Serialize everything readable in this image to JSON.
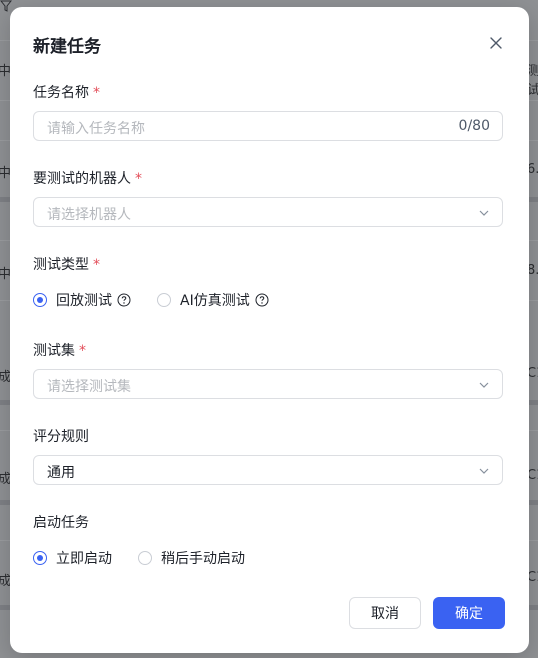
{
  "background": {
    "left_fragments": [
      "中",
      "中",
      "中",
      "成",
      "成",
      "成"
    ],
    "right_fragments": [
      "测试",
      "6.",
      "8.",
      "C1",
      "C1",
      "C1"
    ]
  },
  "dialog": {
    "title": "新建任务",
    "required_mark": "*",
    "task_name": {
      "label": "任务名称",
      "placeholder": "请输入任务名称",
      "counter": "0/80"
    },
    "robot": {
      "label": "要测试的机器人",
      "placeholder": "请选择机器人"
    },
    "test_type": {
      "label": "测试类型",
      "options": [
        "回放测试",
        "AI仿真测试"
      ],
      "selected": "回放测试"
    },
    "test_set": {
      "label": "测试集",
      "placeholder": "请选择测试集"
    },
    "scoring": {
      "label": "评分规则",
      "value": "通用"
    },
    "launch": {
      "label": "启动任务",
      "options": [
        "立即启动",
        "稍后手动启动"
      ],
      "selected": "立即启动"
    },
    "cancel_label": "取消",
    "confirm_label": "确定"
  },
  "colors": {
    "accent": "#3a62f2",
    "required": "#e34d59"
  }
}
